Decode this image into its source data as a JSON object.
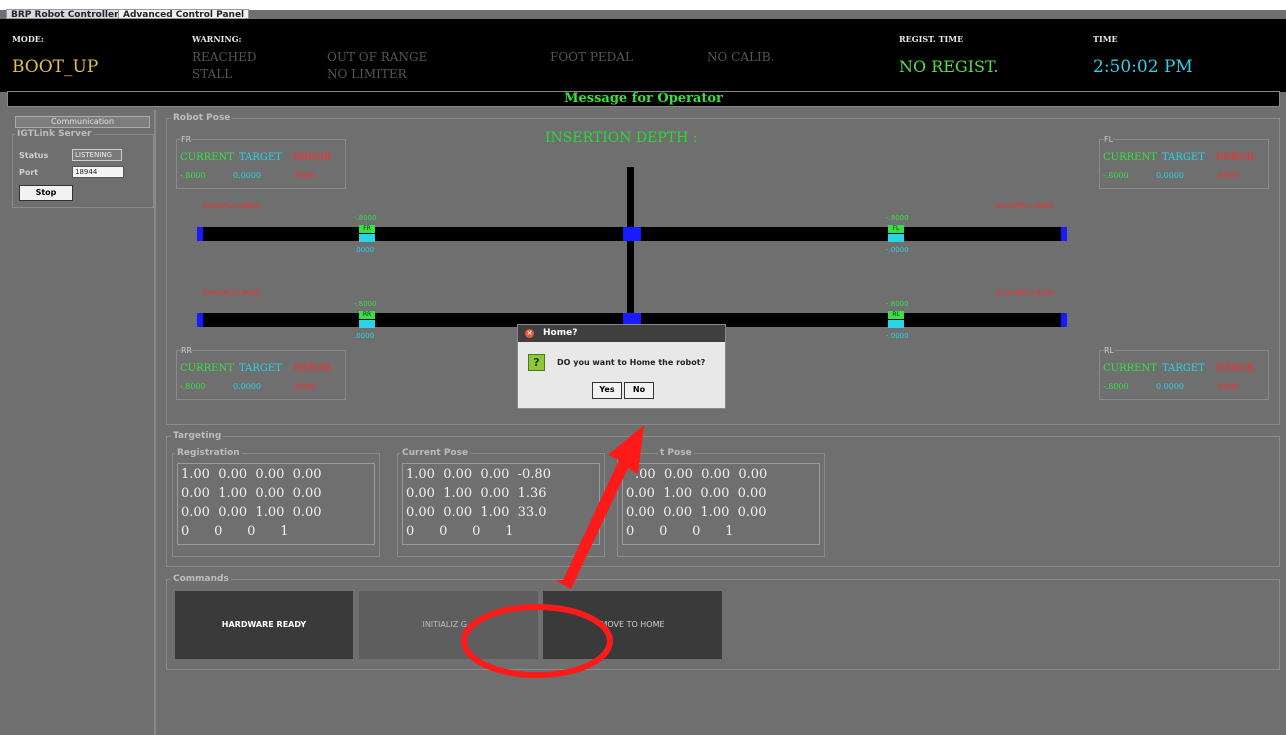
{
  "tabs": [
    "BRP Robot Controller",
    "Advanced Control Panel"
  ],
  "status": {
    "mode_label": "MODE:",
    "mode_value": "BOOT_UP",
    "warning_label": "WARNING:",
    "warnings_row1": [
      "REACHED",
      "OUT OF RANGE",
      "FOOT PEDAL",
      "NO CALIB."
    ],
    "warnings_row2": [
      "STALL",
      "NO LIMITER"
    ],
    "regist_label": "REGIST. TIME",
    "regist_value": "NO REGIST.",
    "time_label": "TIME",
    "time_value": "2:50:02 PM"
  },
  "message_bar": "Message for Operator",
  "communication": {
    "button": "Communication",
    "server_title": "IGTLink Server",
    "status_label": "Status",
    "status_value": "LISTENING",
    "port_label": "Port",
    "port_value": "18944",
    "stop_label": "Stop"
  },
  "robot_pose": {
    "title": "Robot Pose",
    "insertion_label": "INSERTION DEPTH :",
    "col_current": "CURRENT",
    "col_target": "TARGET",
    "col_error": "ERROR",
    "val_current": "-.8000",
    "val_target": "0.0000",
    "val_error": ".8000",
    "boxes": {
      "fr": "FR",
      "fl": "FL",
      "rr": "RR",
      "rl": "RL"
    },
    "errors": {
      "fl": "Error(FL)=.8000",
      "fr": "Error(FR)=.8000",
      "rl": "Error(RL)=.8000",
      "rr": "Error(RR)=.8000"
    },
    "markers": {
      "top_val": "-.8000",
      "bot_val": ".0000",
      "bot_val2": "-.0000",
      "left1": "FR",
      "right1": "FL",
      "left2": "RR",
      "right2": "RL"
    }
  },
  "targeting": {
    "title": "Targeting",
    "registration": {
      "title": "Registration",
      "rows": [
        "1.00  0.00  0.00  0.00",
        "0.00  1.00  0.00  0.00",
        "0.00  0.00  1.00  0.00",
        "0      0      0      1"
      ]
    },
    "current_pose": {
      "title": "Current Pose",
      "rows": [
        "1.00  0.00  0.00  -0.80",
        "0.00  1.00  0.00  1.36",
        "0.00  0.00  1.00  33.0",
        "0      0      0      1"
      ]
    },
    "target_pose": {
      "title": "t Pose",
      "rows": [
        ".00  0.00  0.00  0.00",
        "0.00  1.00  0.00  0.00",
        "0.00  0.00  1.00  0.00",
        "0      0      0      1"
      ]
    }
  },
  "commands": {
    "title": "Commands",
    "hardware_ready": "HARDWARE READY",
    "initializing": "INITIALIZ     G...",
    "move_to_home": "MOVE TO HOME"
  },
  "dialog": {
    "title": "Home?",
    "question_icon": "?",
    "message": "DO you want to Home the robot?",
    "yes_label": "Yes",
    "no_label": "No"
  },
  "colors": {
    "annotation": "#ff1a1a",
    "current": "#38e048",
    "target": "#2ad3e6",
    "error": "#ff2b2b",
    "mode": "#e2c24a"
  }
}
